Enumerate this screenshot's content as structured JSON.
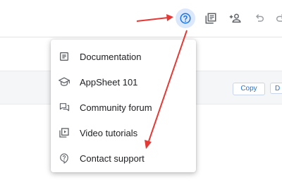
{
  "toolbar": {
    "icons": [
      "help-icon",
      "guide-icon",
      "add-user-icon",
      "undo-icon",
      "redo-icon"
    ],
    "accent_color": "#1a73e8",
    "help_highlight_color": "#dbe7fb"
  },
  "content": {
    "copy_label": "Copy",
    "next_label": "D"
  },
  "help_menu": {
    "items": [
      {
        "label": "Documentation",
        "icon": "document-icon"
      },
      {
        "label": "AppSheet 101",
        "icon": "school-cap-icon"
      },
      {
        "label": "Community forum",
        "icon": "forum-icon"
      },
      {
        "label": "Video tutorials",
        "icon": "video-library-icon"
      },
      {
        "label": "Contact support",
        "icon": "contact-support-icon"
      }
    ]
  },
  "annotation": {
    "arrow_color": "#e53935"
  }
}
